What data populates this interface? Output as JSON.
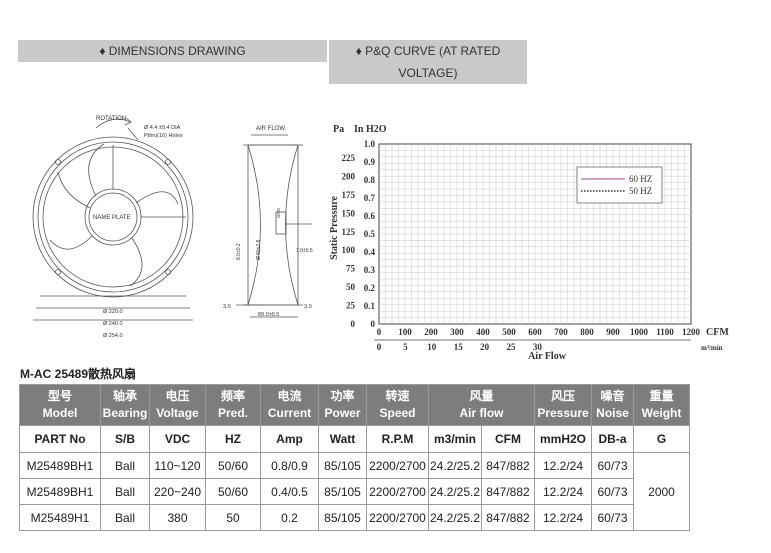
{
  "tabs": {
    "dimensions": "♦ DIMENSIONS DRAWING",
    "pq_line1": "♦ P&Q CURVE (AT RATED",
    "pq_line2": "VOLTAGE)"
  },
  "drawing": {
    "rotation": "ROTATION",
    "holes_line1": "Ø 4.4 ±0.4 DIA",
    "holes_line2": "Pthru(16) Holes",
    "nameplate": "NAME PLATE",
    "d220": "Ø 220.0",
    "d240": "Ø 240.0",
    "d254": "Ø 254.0",
    "airflow": "AIR FLOW",
    "dim_8": "8.0±0.2",
    "dim_50": "Ø 50x2.8",
    "dim_7": "7.0±0.5",
    "dim_3a": "3.0",
    "dim_3b": "3.0",
    "dim_89": "89.0±0.5",
    "gnd": "GND"
  },
  "chart_data": {
    "type": "line",
    "y_unit_pa": "Pa",
    "y_unit_inh2o": "In H2O",
    "ylabel": "Static Pressure",
    "xlabel": "Air Flow",
    "pa_ticks": [
      "225",
      "200",
      "175",
      "150",
      "125",
      "100",
      "75",
      "50",
      "25",
      "0"
    ],
    "inh2o_ticks": [
      "1.0",
      "0.9",
      "0.8",
      "0.7",
      "0.6",
      "0.5",
      "0.4",
      "0.3",
      "0.2",
      "0.1",
      "0"
    ],
    "cfm_ticks": [
      "0",
      "100",
      "200",
      "300",
      "400",
      "500",
      "600",
      "700",
      "800",
      "900",
      "1000",
      "1100",
      "1200"
    ],
    "cfm_unit": "CFM",
    "m3_ticks": [
      "0",
      "5",
      "10",
      "15",
      "20",
      "25",
      "30"
    ],
    "m3_unit": "m³/min",
    "ylim_pa": [
      0,
      250
    ],
    "xlim_cfm": [
      0,
      1200
    ],
    "grid": true,
    "legend": [
      {
        "name": "60 HZ",
        "color": "#9b3f9b",
        "style": "solid"
      },
      {
        "name": "50 HZ",
        "color": "#333333",
        "style": "dotted"
      }
    ],
    "legend_position": "top-right"
  },
  "subtitle": "M-AC 25489散热风扇",
  "table": {
    "headers": [
      {
        "cn": "型号",
        "en": "Model",
        "colspan": 1
      },
      {
        "cn": "轴承",
        "en": "Bearing",
        "colspan": 1
      },
      {
        "cn": "电压",
        "en": "Voltage",
        "colspan": 1
      },
      {
        "cn": "频率",
        "en": "Pred.",
        "colspan": 1
      },
      {
        "cn": "电流",
        "en": "Current",
        "colspan": 1
      },
      {
        "cn": "功率",
        "en": "Power",
        "colspan": 1
      },
      {
        "cn": "转速",
        "en": "Speed",
        "colspan": 1
      },
      {
        "cn": "风量",
        "en": "Air flow",
        "colspan": 2
      },
      {
        "cn": "风压",
        "en": "Pressure",
        "colspan": 1
      },
      {
        "cn": "噪音",
        "en": "Noise",
        "colspan": 1
      },
      {
        "cn": "重量",
        "en": "Weight",
        "colspan": 1
      }
    ],
    "units": [
      "PART No",
      "S/B",
      "VDC",
      "HZ",
      "Amp",
      "Watt",
      "R.P.M",
      "m3/min",
      "CFM",
      "mmH2O",
      "DB-a",
      "G"
    ],
    "rows": [
      [
        "M25489BH1",
        "Ball",
        "110~120",
        "50/60",
        "0.8/0.9",
        "85/105",
        "2200/2700",
        "24.2/25.2",
        "847/882",
        "12.2/24",
        "60/73"
      ],
      [
        "M25489BH1",
        "Ball",
        "220~240",
        "50/60",
        "0.4/0.5",
        "85/105",
        "2200/2700",
        "24.2/25.2",
        "847/882",
        "12.2/24",
        "60/73"
      ],
      [
        "M25489H1",
        "Ball",
        "380",
        "50",
        "0.2",
        "85/105",
        "2200/2700",
        "24.2/25.2",
        "847/882",
        "12.2/24",
        "60/73"
      ]
    ],
    "weight": "2000"
  }
}
